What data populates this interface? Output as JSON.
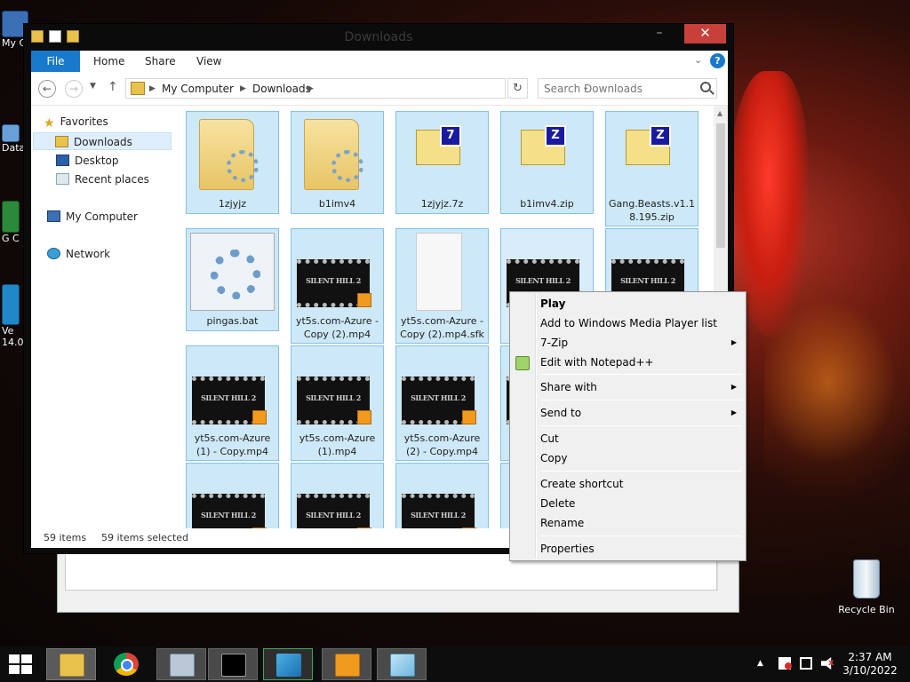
{
  "desktop": {
    "left_icons": [
      "My C",
      "Data",
      "G C",
      "Ve 14.0"
    ],
    "recycle_bin": "Recycle Bin"
  },
  "window": {
    "title": "Downloads",
    "min": "–",
    "max": "☐",
    "close": "✕"
  },
  "ribbon": {
    "file": "File",
    "home": "Home",
    "share": "Share",
    "view": "View",
    "help": "?"
  },
  "address": {
    "crumbs": [
      "My Computer",
      "Downloads"
    ],
    "search_placeholder": "Search Downloads"
  },
  "nav": {
    "favorites": "Favorites",
    "downloads": "Downloads",
    "desktop": "Desktop",
    "recent": "Recent places",
    "computer": "My Computer",
    "network": "Network"
  },
  "files": [
    "1zjyjz",
    "b1imv4",
    "1zjyjz.7z",
    "b1imv4.zip",
    "Gang.Beasts.v1.18.195.zip",
    "pingas.bat",
    "yt5s.com-Azure - Copy (2).mp4",
    "yt5s.com-Azure - Copy (2).mp4.sfk",
    "yt5s.com-Azure (1) - Copy.mp4",
    "yt5s.com-Azure (1).mp4",
    "yt5s.com-Azure (2) - Copy.mp4"
  ],
  "status": {
    "count": "59 items",
    "selected": "59 items selected"
  },
  "context_menu": {
    "play": "Play",
    "add_wmp": "Add to Windows Media Player list",
    "zip": "7-Zip",
    "notepad": "Edit with Notepad++",
    "share_with": "Share with",
    "send_to": "Send to",
    "cut": "Cut",
    "copy": "Copy",
    "create_shortcut": "Create shortcut",
    "delete": "Delete",
    "rename": "Rename",
    "properties": "Properties",
    "submenu_arrow": "▶"
  },
  "clock": {
    "time": "2:37 AM",
    "date": "3/10/2022"
  },
  "colors": {
    "accent": "#1979ca",
    "selection": "#cde8f7",
    "close_button": "#c7403a"
  }
}
